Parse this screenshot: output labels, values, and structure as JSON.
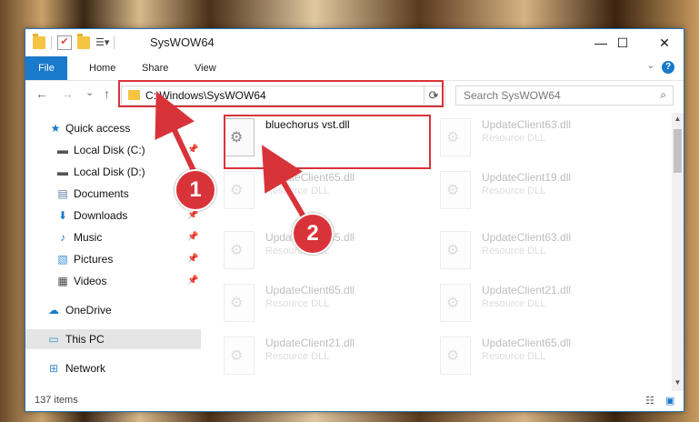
{
  "window": {
    "title": "SysWOW64",
    "controls": {
      "minimize": "—",
      "maximize": "☐",
      "close": "✕"
    }
  },
  "ribbon": {
    "tabs": [
      "File",
      "Home",
      "Share",
      "View"
    ],
    "help": "?"
  },
  "navigation": {
    "back": "←",
    "forward": "→",
    "recent": "⌄",
    "up": "↑",
    "address": "C:\\Windows\\SysWOW64",
    "refresh": "⟳",
    "search_placeholder": "Search SysWOW64"
  },
  "sidebar": {
    "items": [
      {
        "label": "Quick access",
        "icon": "star-icon"
      },
      {
        "label": "Local Disk (C:)",
        "icon": "drive-icon"
      },
      {
        "label": "Local Disk (D:)",
        "icon": "drive-icon"
      },
      {
        "label": "Documents",
        "icon": "documents-icon"
      },
      {
        "label": "Downloads",
        "icon": "download-icon"
      },
      {
        "label": "Music",
        "icon": "music-icon"
      },
      {
        "label": "Pictures",
        "icon": "pictures-icon"
      },
      {
        "label": "Videos",
        "icon": "videos-icon"
      },
      {
        "label": "OneDrive",
        "icon": "cloud-icon"
      },
      {
        "label": "This PC",
        "icon": "computer-icon"
      },
      {
        "label": "Network",
        "icon": "network-icon"
      }
    ]
  },
  "files": {
    "highlighted": {
      "name": "bluechorus vst.dll"
    },
    "left_column": [
      {
        "name": "UpdateClient65.dll",
        "type": "Resource DLL"
      },
      {
        "name": "UpdateClient65.dll",
        "type": "Resource DLL"
      },
      {
        "name": "UpdateClient65.dll",
        "type": "Resource DLL"
      },
      {
        "name": "UpdateClient21.dll",
        "type": "Resource DLL"
      }
    ],
    "right_column": [
      {
        "name": "UpdateClient63.dll",
        "type": "Resource DLL"
      },
      {
        "name": "UpdateClient19.dll",
        "type": "Resource DLL"
      },
      {
        "name": "UpdateClient63.dll",
        "type": "Resource DLL"
      },
      {
        "name": "UpdateClient21.dll",
        "type": "Resource DLL"
      },
      {
        "name": "UpdateClient65.dll",
        "type": "Resource DLL"
      }
    ]
  },
  "status": {
    "item_count": "137 items"
  },
  "annotations": {
    "step1": "1",
    "step2": "2"
  },
  "colors": {
    "accent": "#1979ca",
    "annotation_red": "#d9333a"
  }
}
